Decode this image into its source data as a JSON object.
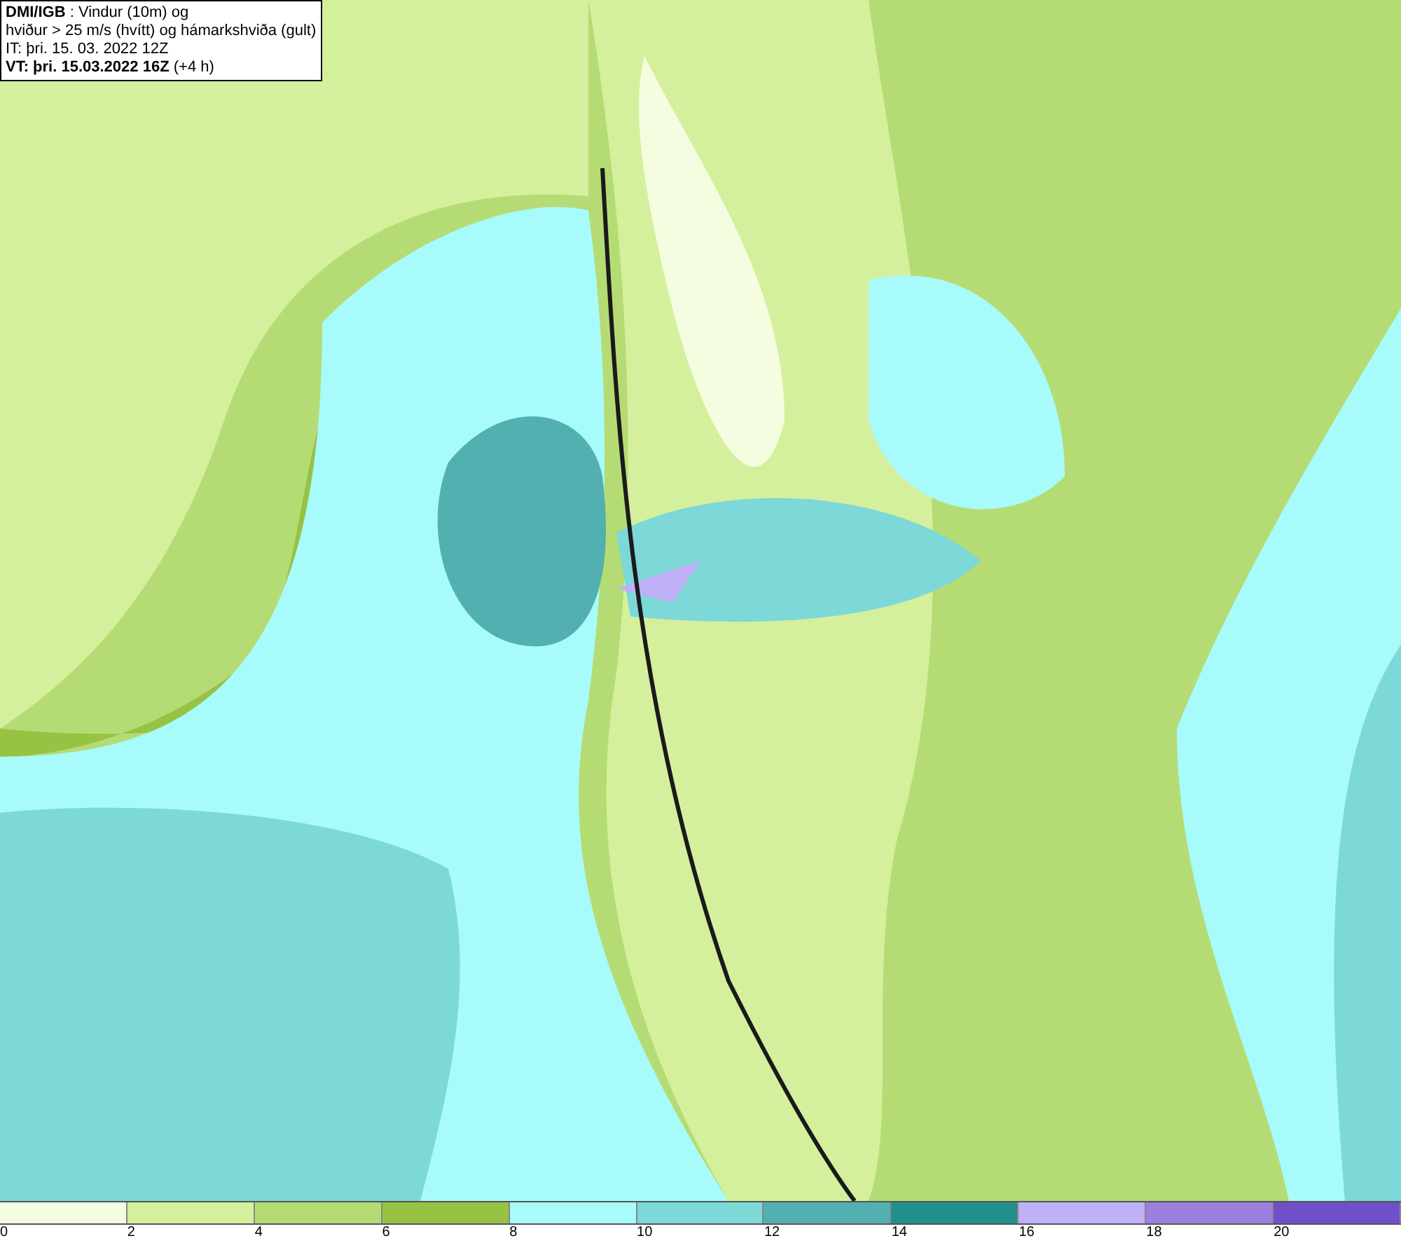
{
  "info_box": {
    "lines": [
      "**DMI/IGB** : Vindur (10m) og",
      "hviður > 25 m/s (hvítt) og hámarkshviða (gult)",
      "IT: þri. 15. 03. 2022 12Z",
      "**VT: þri. 15.03.2022 16Z** (+4 h)"
    ]
  },
  "legend": {
    "segments": [
      {
        "label": "0",
        "color": "#f5fde0"
      },
      {
        "label": "2",
        "color": "#d4f09c"
      },
      {
        "label": "4",
        "color": "#b5dc74"
      },
      {
        "label": "6",
        "color": "#98c244"
      },
      {
        "label": "8",
        "color": "#a8fbfb"
      },
      {
        "label": "10",
        "color": "#7dd8d8"
      },
      {
        "label": "12",
        "color": "#52b0b0"
      },
      {
        "label": "14",
        "color": "#21908c"
      },
      {
        "label": "16",
        "color": "#c0b0f8"
      },
      {
        "label": "18",
        "color": "#9b80e0"
      },
      {
        "label": "20",
        "color": "#7050c8"
      }
    ]
  }
}
